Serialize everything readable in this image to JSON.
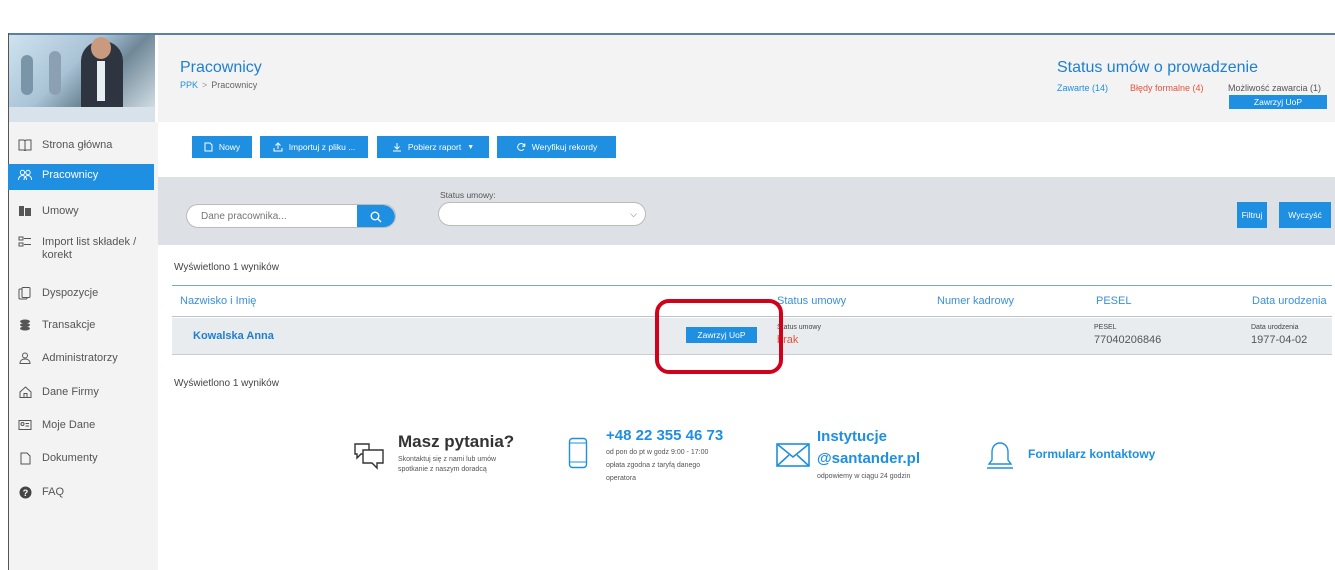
{
  "header": {
    "title": "Pracownicy",
    "breadcrumb_root": "PPK",
    "breadcrumb_sep": ">",
    "breadcrumb_current": "Pracownicy",
    "status_title": "Status umów o prowadzenie",
    "stat_concluded": "Zawarte (14)",
    "stat_errors": "Błędy formalne (4)",
    "stat_possible": "Możliwość zawarcia (1)",
    "conclude_button": "Zawrzyj UoP"
  },
  "sidebar": {
    "items": [
      {
        "label": "Strona główna",
        "icon": "book-icon"
      },
      {
        "label": "Pracownicy",
        "icon": "users-icon"
      },
      {
        "label": "Umowy",
        "icon": "contract-icon"
      },
      {
        "label": "Import list składek / korekt",
        "icon": "import-list-icon"
      },
      {
        "label": "Dyspozycje",
        "icon": "documents-icon"
      },
      {
        "label": "Transakcje",
        "icon": "coins-icon"
      },
      {
        "label": "Administratorzy",
        "icon": "user-icon"
      },
      {
        "label": "Dane Firmy",
        "icon": "home-icon"
      },
      {
        "label": "Moje Dane",
        "icon": "id-card-icon"
      },
      {
        "label": "Dokumenty",
        "icon": "document-icon"
      },
      {
        "label": "FAQ",
        "icon": "question-icon"
      }
    ]
  },
  "toolbar": {
    "new": "Nowy",
    "import": "Importuj z pliku ...",
    "report": "Pobierz raport",
    "verify": "Weryfikuj rekordy"
  },
  "filters": {
    "search_placeholder": "Dane pracownika...",
    "status_label": "Status umowy:",
    "filter_button": "Filtruj",
    "clear_button": "Wyczyść"
  },
  "table": {
    "count_top": "Wyświetlono 1 wyników",
    "count_bottom": "Wyświetlono 1 wyników",
    "columns": {
      "name": "Nazwisko i Imię",
      "status": "Status umowy",
      "number": "Numer kadrowy",
      "pesel": "PESEL",
      "birth": "Data urodzenia"
    },
    "row": {
      "name": "Kowalska Anna",
      "action": "Zawrzyj UoP",
      "status_label": "Status umowy",
      "status_value": "brak",
      "pesel_label": "PESEL",
      "pesel": "77040206846",
      "birth_label": "Data urodzenia",
      "birth": "1977-04-02"
    }
  },
  "footer": {
    "questions_title": "Masz pytania?",
    "questions_line1": "Skontaktuj się z nami lub umów",
    "questions_line2": "spotkanie z naszym doradcą",
    "phone": "+48 22 355 46 73",
    "phone_line1": "od pon do pt w godz 9:00 - 17:00",
    "phone_line2": "opłata zgodna z taryfą danego",
    "phone_line3": "operatora",
    "email_line1": "Instytucje",
    "email_line2": "@santander.pl",
    "email_note": "odpowiemy w ciągu 24 godzin",
    "form": "Formularz kontaktowy"
  },
  "colors": {
    "accent": "#1e8fe1",
    "error": "#e5533d",
    "highlight": "#d0021b"
  }
}
